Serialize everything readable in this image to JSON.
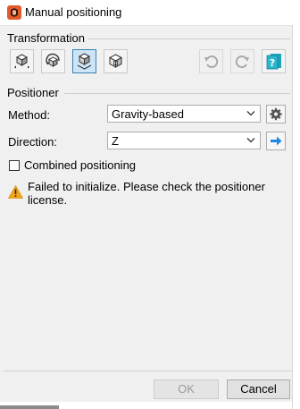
{
  "window": {
    "title": "Manual positioning"
  },
  "transformation": {
    "label": "Transformation",
    "tools": [
      {
        "icon": "translate-cube-icon",
        "active": false
      },
      {
        "icon": "rotate-cube-icon",
        "active": false
      },
      {
        "icon": "position-cube-icon",
        "active": true
      },
      {
        "icon": "cube-wireframe-icon",
        "active": false
      }
    ],
    "actions": [
      {
        "icon": "undo-icon",
        "enabled": false
      },
      {
        "icon": "redo-icon",
        "enabled": false
      },
      {
        "icon": "help-book-icon",
        "enabled": true
      }
    ]
  },
  "positioner": {
    "label": "Positioner",
    "method": {
      "label": "Method:",
      "value": "Gravity-based"
    },
    "direction": {
      "label": "Direction:",
      "value": "Z"
    },
    "combined": {
      "label": "Combined positioning",
      "checked": false
    },
    "message": "Failed to initialize. Please check the positioner license."
  },
  "footer": {
    "ok_label": "OK",
    "cancel_label": "Cancel"
  },
  "colors": {
    "accent": "#1e88e5",
    "warning": "#f2a516",
    "active_bg": "#cce4f7"
  }
}
